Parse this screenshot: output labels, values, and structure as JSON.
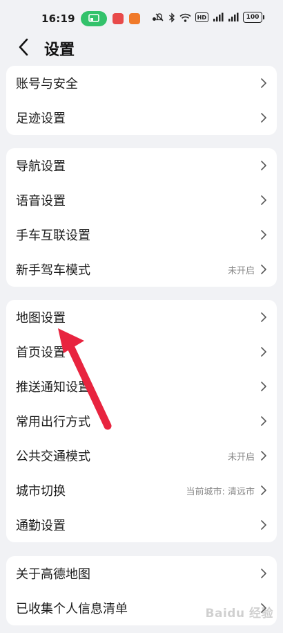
{
  "status_bar": {
    "time": "16:19",
    "battery": "100",
    "hd_label": "HD"
  },
  "header": {
    "back_icon": "chevron-left-icon",
    "title": "设置"
  },
  "groups": [
    {
      "items": [
        {
          "label": "账号与安全",
          "value": ""
        },
        {
          "label": "足迹设置",
          "value": ""
        }
      ]
    },
    {
      "items": [
        {
          "label": "导航设置",
          "value": ""
        },
        {
          "label": "语音设置",
          "value": ""
        },
        {
          "label": "手车互联设置",
          "value": ""
        },
        {
          "label": "新手驾车模式",
          "value": "未开启"
        }
      ]
    },
    {
      "items": [
        {
          "label": "地图设置",
          "value": ""
        },
        {
          "label": "首页设置",
          "value": ""
        },
        {
          "label": "推送通知设置",
          "value": ""
        },
        {
          "label": "常用出行方式",
          "value": ""
        },
        {
          "label": "公共交通模式",
          "value": "未开启"
        },
        {
          "label": "城市切换",
          "value": "当前城市: 清远市"
        },
        {
          "label": "通勤设置",
          "value": ""
        }
      ]
    },
    {
      "items": [
        {
          "label": "关于高德地图",
          "value": ""
        },
        {
          "label": "已收集个人信息清单",
          "value": ""
        }
      ]
    }
  ],
  "watermark": "Baidu 经验",
  "colors": {
    "background": "#f1f2f5",
    "card": "#ffffff",
    "text": "#1b1b1b",
    "secondary_text": "#8a8a8a",
    "annotation_arrow": "#e8243f",
    "cast_pill": "#33c26b"
  }
}
